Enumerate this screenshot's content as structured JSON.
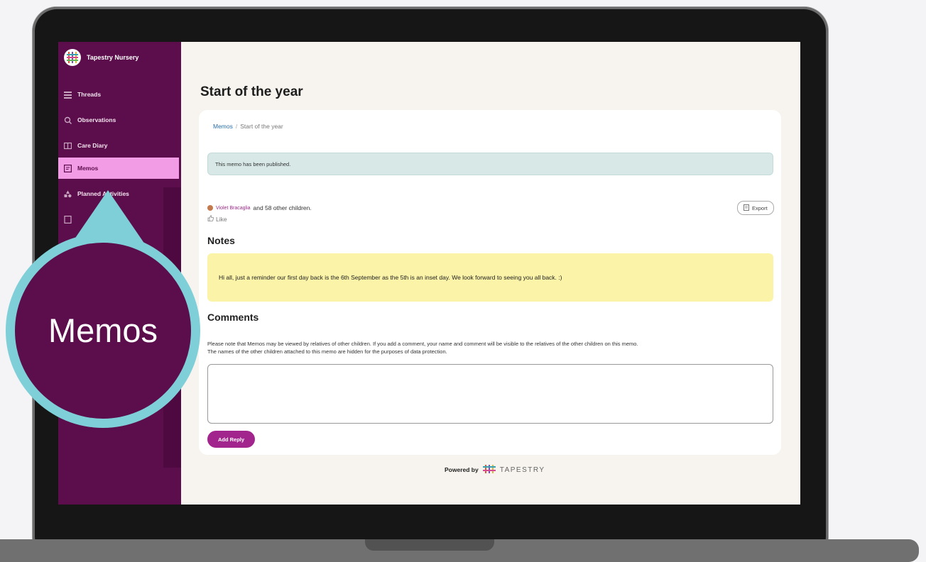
{
  "brand": {
    "name": "Tapestry Nursery"
  },
  "sidebar": {
    "items": [
      {
        "label": "Threads",
        "icon": "threads-icon"
      },
      {
        "label": "Observations",
        "icon": "observations-icon"
      },
      {
        "label": "Care Diary",
        "icon": "care-diary-icon"
      },
      {
        "label": "Memos",
        "icon": "memos-icon",
        "active": true
      },
      {
        "label": "Planned Activities",
        "icon": "planned-activities-icon"
      }
    ]
  },
  "page": {
    "title": "Start of the year"
  },
  "breadcrumb": {
    "link": "Memos",
    "separator": "/",
    "current": "Start of the year"
  },
  "alert": {
    "text": "This memo has been published."
  },
  "children": {
    "child_name": "Violet Bracaglia",
    "others_text": "and 58 other children."
  },
  "like": {
    "label": "Like"
  },
  "export": {
    "label": "Export"
  },
  "notes": {
    "heading": "Notes",
    "text": "Hi all, just a reminder our first day back is the 6th September as the 5th is an inset day. We look forward to seeing you all back. :)"
  },
  "comments": {
    "heading": "Comments",
    "note_line1": "Please note that Memos may be viewed by relatives of other children. If you add a comment, your name and comment will be visible to the relatives of the other children on this memo.",
    "note_line2": "The names of the other children attached to this memo are hidden for the purposes of data protection.",
    "reply_value": "",
    "add_reply_label": "Add Reply"
  },
  "footer": {
    "powered_by": "Powered by",
    "brand": "TAPESTRY"
  },
  "callout": {
    "label": "Memos",
    "fill_color": "#5c0e4c",
    "ring_color": "#7fcfd8"
  },
  "colors": {
    "sidebar": "#5c0e4c",
    "active_item": "#f39ce6",
    "accent": "#a2258d",
    "notes_bg": "#fbf4a8",
    "alert_bg": "#d7e8e7"
  }
}
